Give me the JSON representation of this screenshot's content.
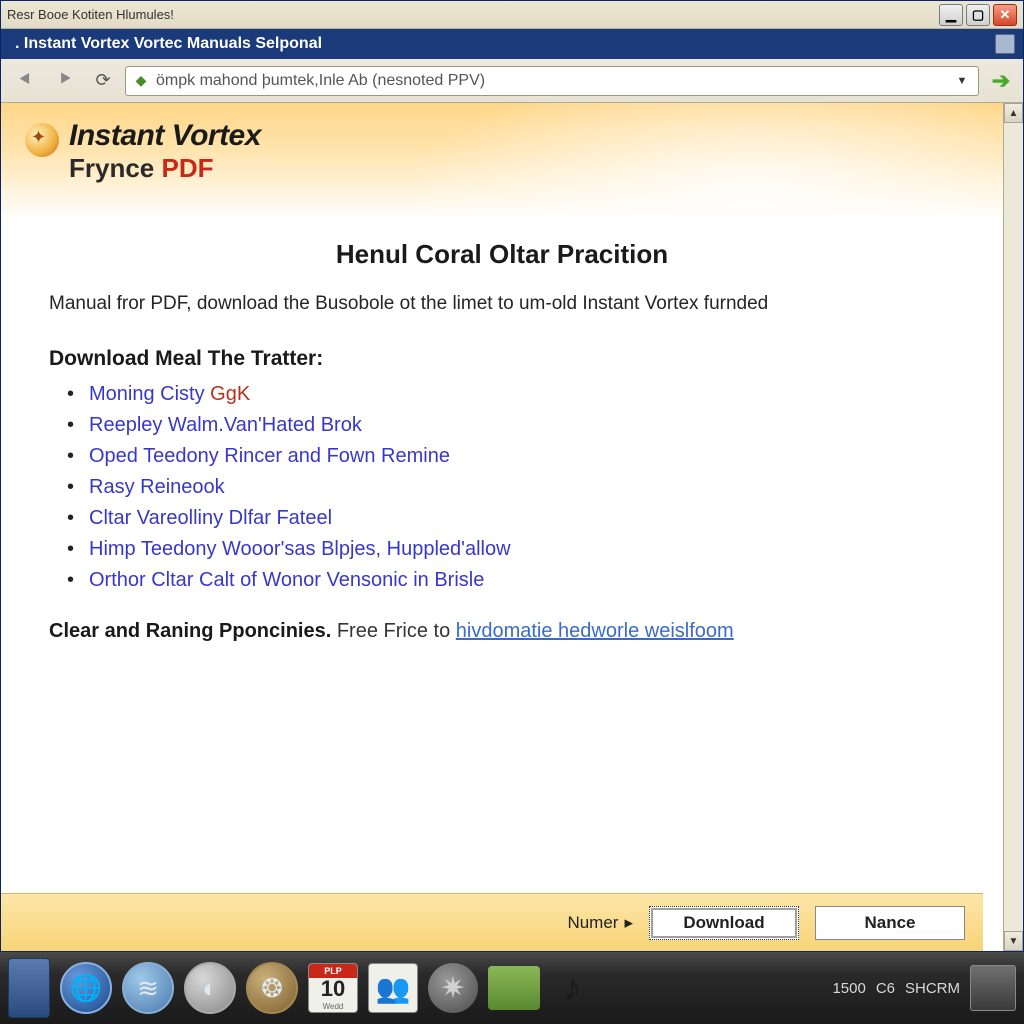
{
  "window": {
    "title": "Resr Booe Kotiten Hlumules!",
    "tab": ". Instant Vortex Vortec Manuals Selponal",
    "address": "ömpk mahond þumtek,Inle Ab (nesnoted PPV)"
  },
  "brand": {
    "line1": "Instant Vortex",
    "line2a": "Frynce ",
    "line2b": "PDF"
  },
  "page": {
    "heading": "Henul Coral Oltar Pracition",
    "intro": "Manual fror PDF, download the Busobole ot the limet to um-old Instant Vortex furnded",
    "download_header": "Download Meal The Tratter:",
    "links": [
      {
        "text": "Moning Cisty ",
        "accent": "GgK"
      },
      {
        "text": "Reepley Walm.Van'Hated Brok",
        "accent": ""
      },
      {
        "text": "Oped Teedony Rincer and Fown Remine",
        "accent": ""
      },
      {
        "text": "Rasy Reineook",
        "accent": ""
      },
      {
        "text": "Cltar Vareolliny Dlfar Fateel",
        "accent": ""
      },
      {
        "text": "Himp Teedony Wooor'sas Blpjes, Huppled'allow",
        "accent": ""
      },
      {
        "text": "Orthor Cltar Calt of Wonor Vensonic in Brisle",
        "accent": ""
      }
    ],
    "footer_bold": "Clear and Raning Pponcinies.",
    "footer_plain": " Free Frice to ",
    "footer_link": "hivdomatie hedworle weislfoom"
  },
  "bottombar": {
    "label": "Numer",
    "download": "Download",
    "nance": "Nance"
  },
  "taskbar": {
    "cal_top": "PLP",
    "cal_num": "10",
    "cal_sub": "Wedd",
    "tray_time": "1500",
    "tray_c": "C6",
    "tray_s": "SHCRM"
  }
}
